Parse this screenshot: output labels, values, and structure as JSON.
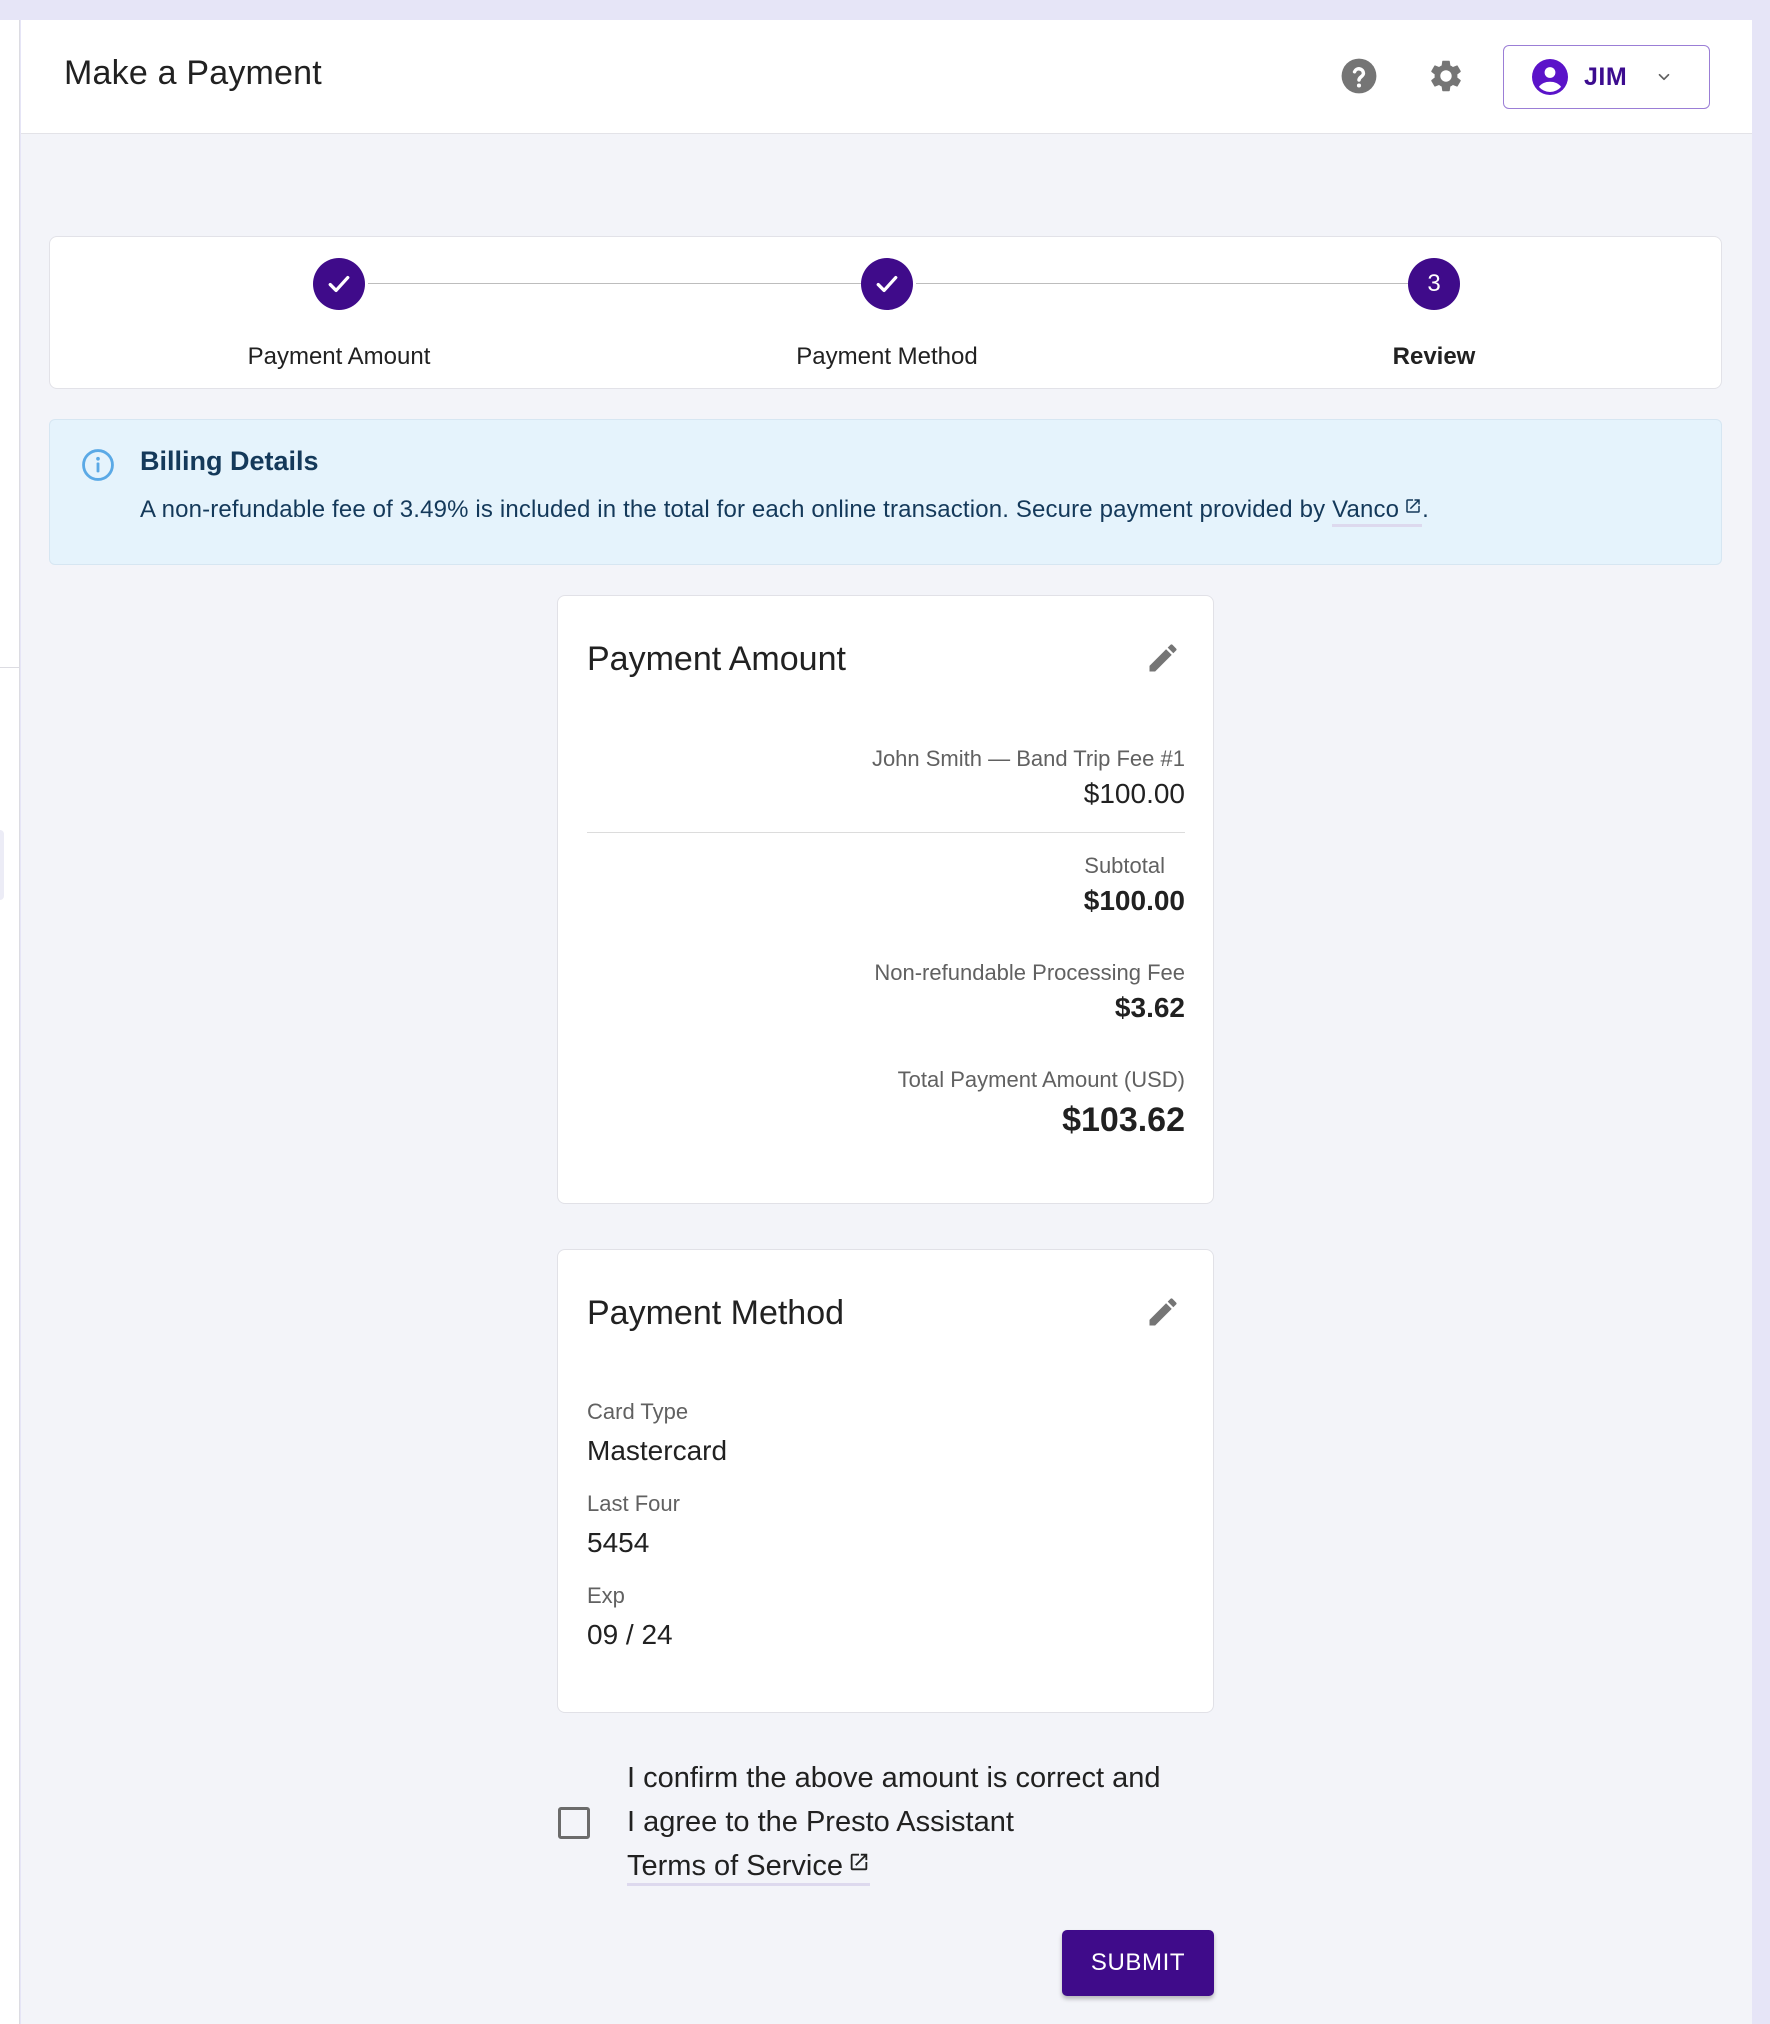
{
  "header": {
    "title": "Make a Payment",
    "help_icon": "help-circle-icon",
    "settings_icon": "gear-icon",
    "user": {
      "name": "JIM",
      "avatar_icon": "account-circle-icon",
      "dropdown_icon": "chevron-down-icon"
    }
  },
  "stepper": {
    "steps": [
      {
        "label": "Payment Amount",
        "state": "completed",
        "marker": "check-icon"
      },
      {
        "label": "Payment Method",
        "state": "completed",
        "marker": "check-icon"
      },
      {
        "label": "Review",
        "state": "active",
        "marker": "3"
      }
    ]
  },
  "billing_banner": {
    "icon": "info-icon",
    "title": "Billing Details",
    "text": "A non-refundable fee of 3.49% is included in the total for each online transaction. Secure payment provided by ",
    "link_text": "Vanco",
    "link_icon": "external-link-icon",
    "trailing": "."
  },
  "payment_amount_card": {
    "title": "Payment Amount",
    "edit_icon": "pencil-icon",
    "line_items": [
      {
        "label": "John Smith — Band Trip Fee #1",
        "amount": "$100.00"
      }
    ],
    "subtotal_label": "Subtotal",
    "subtotal_value": "$100.00",
    "fee_label": "Non-refundable Processing Fee",
    "fee_value": "$3.62",
    "total_label": "Total Payment Amount (USD)",
    "total_value": "$103.62"
  },
  "payment_method_card": {
    "title": "Payment Method",
    "edit_icon": "pencil-icon",
    "fields": [
      {
        "label": "Card Type",
        "value": "Mastercard"
      },
      {
        "label": "Last Four",
        "value": "5454"
      },
      {
        "label": "Exp",
        "value": "09 / 24"
      }
    ]
  },
  "confirm": {
    "checked": false,
    "line1": "I confirm the above amount is correct and",
    "line2": "I agree to the Presto Assistant",
    "link_text": "Terms of Service",
    "link_icon": "external-link-icon"
  },
  "submit_label": "SUBMIT",
  "colors": {
    "primary": "#3f0b8a",
    "banner_bg": "#e5f3fc",
    "banner_text": "#14395a",
    "info_icon": "#5aa9e6",
    "page_bg": "#f3f4f9",
    "frame_bg": "#e6e5f7"
  }
}
